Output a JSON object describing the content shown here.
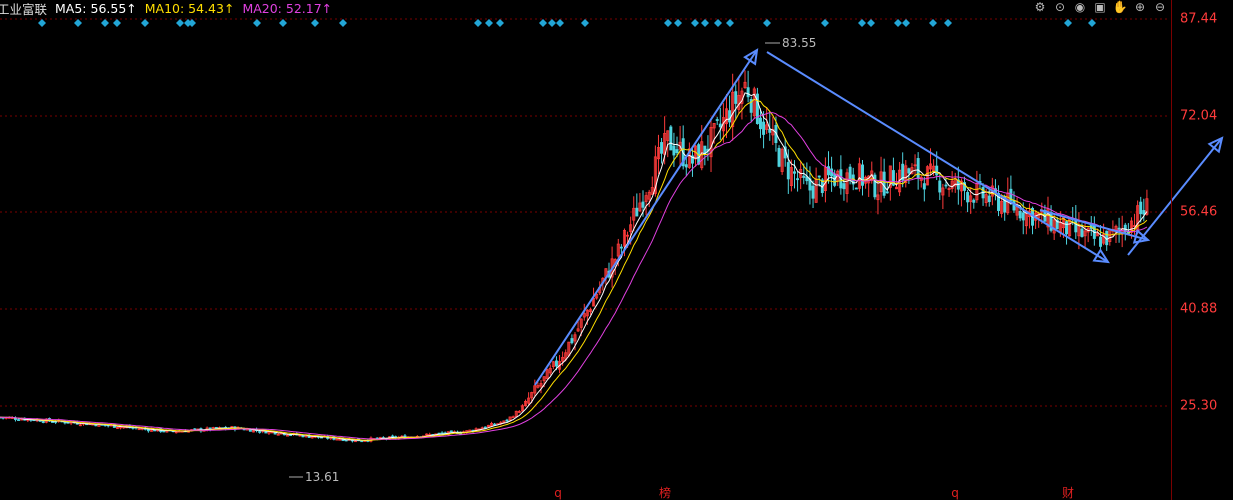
{
  "header": {
    "stock_name": "工业富联",
    "ma5_label": "MA5: 56.55↑",
    "ma10_label": "MA10: 54.43↑",
    "ma20_label": "MA20: 52.17↑"
  },
  "colors": {
    "up": "#ff3b3b",
    "down": "#4fd4e0",
    "ma5": "#ffffff",
    "ma10": "#ffde00",
    "ma20": "#e040e0",
    "grid": "#7a0000",
    "axis_text": "#ff3b3b",
    "arrow": "#5a8cff",
    "marker": "#22a6d6",
    "event": "#e02020"
  },
  "toolbar": {
    "icons": [
      "settings-icon",
      "crosshair-icon",
      "eye-icon",
      "basket-icon",
      "hand-icon",
      "zoom-in-icon",
      "zoom-out-icon"
    ]
  },
  "chart_data": {
    "type": "candlestick",
    "y_ticks": [
      "87.44",
      "72.04",
      "56.46",
      "40.88",
      "25.30"
    ],
    "ylim": [
      13.0,
      89.5
    ],
    "annotations": {
      "high_label": "83.55",
      "low_label": "13.61"
    },
    "event_labels": [
      "q",
      "榜",
      "q",
      "财"
    ],
    "trend_arrows": 4,
    "grid": true
  }
}
